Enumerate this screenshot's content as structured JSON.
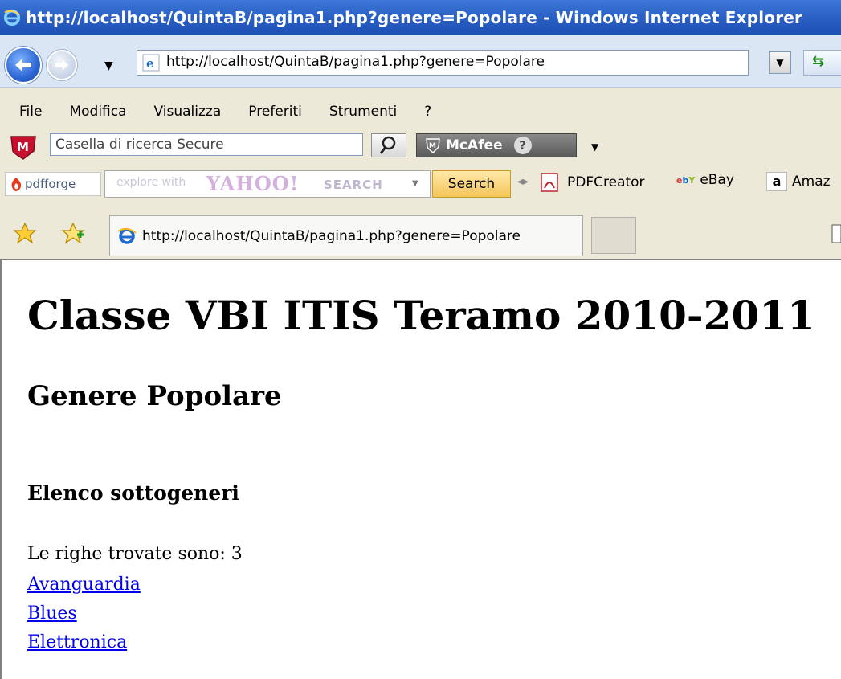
{
  "window": {
    "title": "http://localhost/QuintaB/pagina1.php?genere=Popolare - Windows Internet Explorer"
  },
  "address_bar": {
    "url": "http://localhost/QuintaB/pagina1.php?genere=Popolare"
  },
  "menu": {
    "items": [
      "File",
      "Modifica",
      "Visualizza",
      "Preferiti",
      "Strumenti",
      "?"
    ]
  },
  "mcafee_toolbar": {
    "search_placeholder": "Casella di ricerca Secure",
    "brand": "McAfee",
    "help": "?"
  },
  "pdfforge_toolbar": {
    "logo_text": "pdfforge",
    "search_placeholder": "explore with",
    "yahoo_logo": "YAHOO!",
    "yahoo_search": "SEARCH",
    "search_button": "Search",
    "links": [
      "PDFCreator",
      "eBay",
      "Amaz"
    ],
    "ebay_logo": "ebY",
    "amazon_logo": "a"
  },
  "tabs": {
    "active_tab_title": "http://localhost/QuintaB/pagina1.php?genere=Popolare"
  },
  "page": {
    "heading": "Classe VBI ITIS Teramo 2010-2011",
    "genre_heading": "Genere Popolare",
    "subgenres_heading": "Elenco sottogeneri",
    "rows_found": "Le righe trovate sono: 3",
    "subgenres": [
      "Avanguardia",
      "Blues",
      "Elettronica"
    ]
  }
}
